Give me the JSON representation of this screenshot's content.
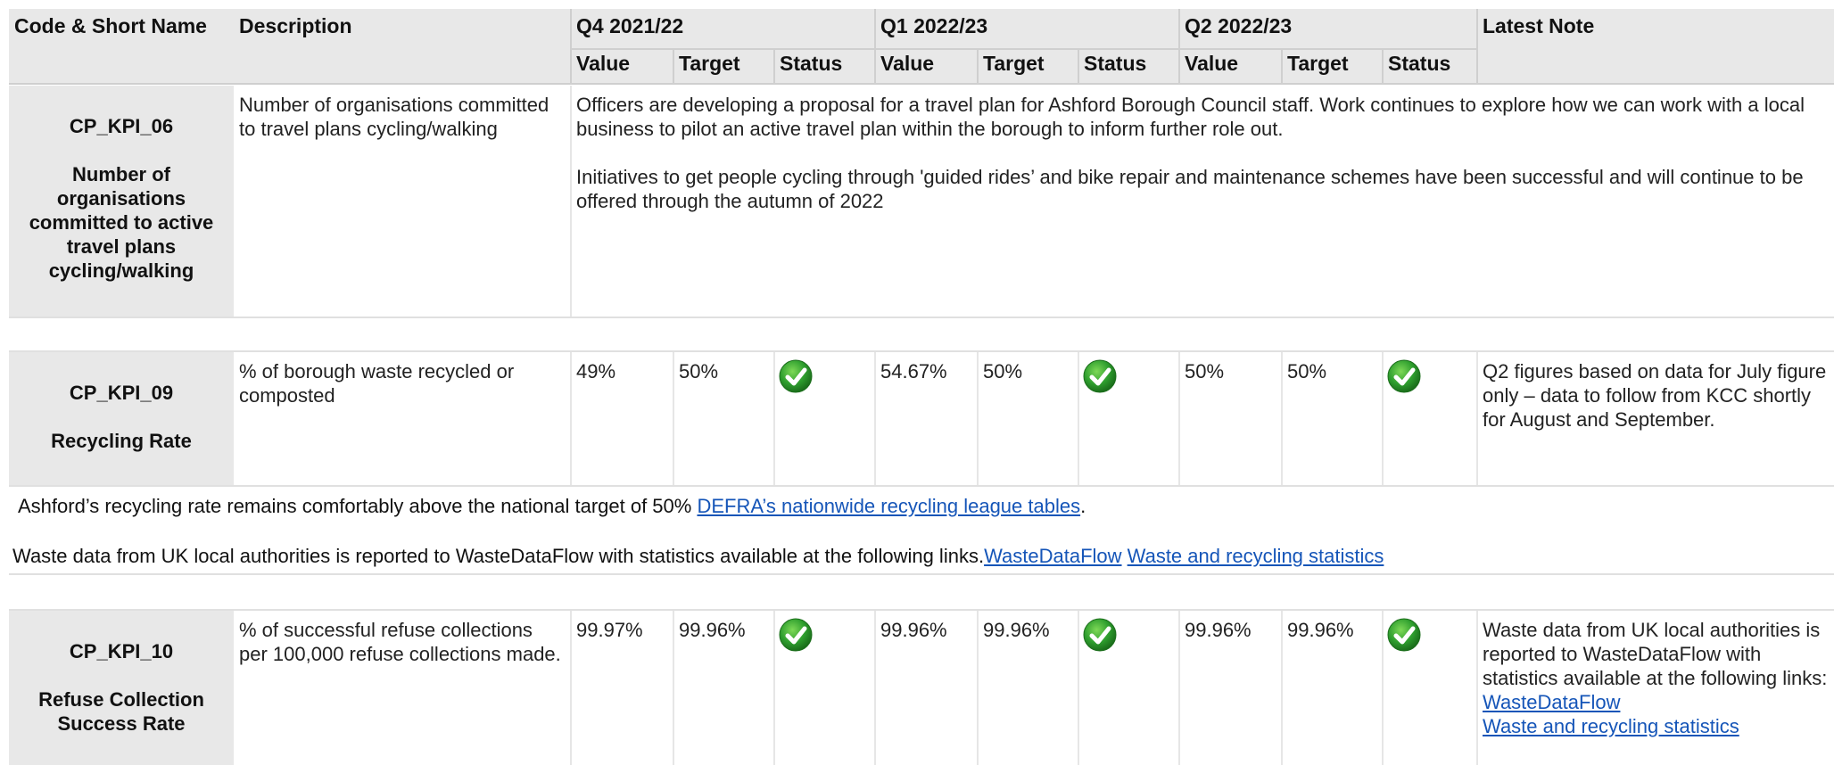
{
  "header": {
    "col_code": "Code & Short Name",
    "col_description": "Description",
    "col_latest_note": "Latest Note",
    "periods": [
      "Q4 2021/22",
      "Q1 2022/23",
      "Q2 2022/23"
    ],
    "sub_value": "Value",
    "sub_target": "Target",
    "sub_status": "Status"
  },
  "rows": [
    {
      "code": "CP_KPI_06",
      "short_name": "Number of organisations committed to active travel plans cycling/walking",
      "description": "Number of organisations committed to travel plans cycling/walking",
      "note_p1": "Officers are developing a proposal for a travel plan for Ashford Borough Council staff. Work continues to explore how we can work with a local business to pilot an active travel plan within the borough to inform further role out.",
      "note_p2": "Initiatives to get people cycling through 'guided rides’ and bike repair and maintenance schemes have been successful and will continue to be offered through the autumn of 2022"
    },
    {
      "code": "CP_KPI_09",
      "short_name": "Recycling Rate",
      "description": "% of borough waste recycled or composted",
      "q4": {
        "value": "49%",
        "target": "50%",
        "status": "ok-icon"
      },
      "q1": {
        "value": "54.67%",
        "target": "50%",
        "status": "ok-icon"
      },
      "q2": {
        "value": "50%",
        "target": "50%",
        "status": "ok-icon"
      },
      "latest_note": "Q2 figures based on data for July figure only – data to follow from KCC shortly for August and September.",
      "footnote_text": "Ashford’s recycling rate remains comfortably above the national target of 50% ",
      "footnote_link": "DEFRA’s nationwide recycling league tables",
      "footnote_end": ".",
      "footnote2_text": "Waste data from UK local authorities is reported to WasteDataFlow with statistics available at the following links.",
      "footnote2_link1": "WasteDataFlow",
      "footnote2_link2": "Waste and recycling statistics"
    },
    {
      "code": "CP_KPI_10",
      "short_name": "Refuse Collection Success Rate",
      "description": "% of successful refuse collections per 100,000 refuse collections made.",
      "q4": {
        "value": "99.97%",
        "target": "99.96%",
        "status": "ok-icon"
      },
      "q1": {
        "value": "99.96%",
        "target": "99.96%",
        "status": "ok-icon"
      },
      "q2": {
        "value": "99.96%",
        "target": "99.96%",
        "status": "ok-icon"
      },
      "latest_note": "Waste data from UK local authorities is reported to WasteDataFlow with statistics available at the following links: ",
      "note_link1": "WasteDataFlow",
      "note_link2": "Waste and recycling statistics"
    }
  ],
  "colors": {
    "header_bg": "#e8e8e8",
    "link": "#1555b8",
    "status_ok": "#2e9e2e"
  }
}
